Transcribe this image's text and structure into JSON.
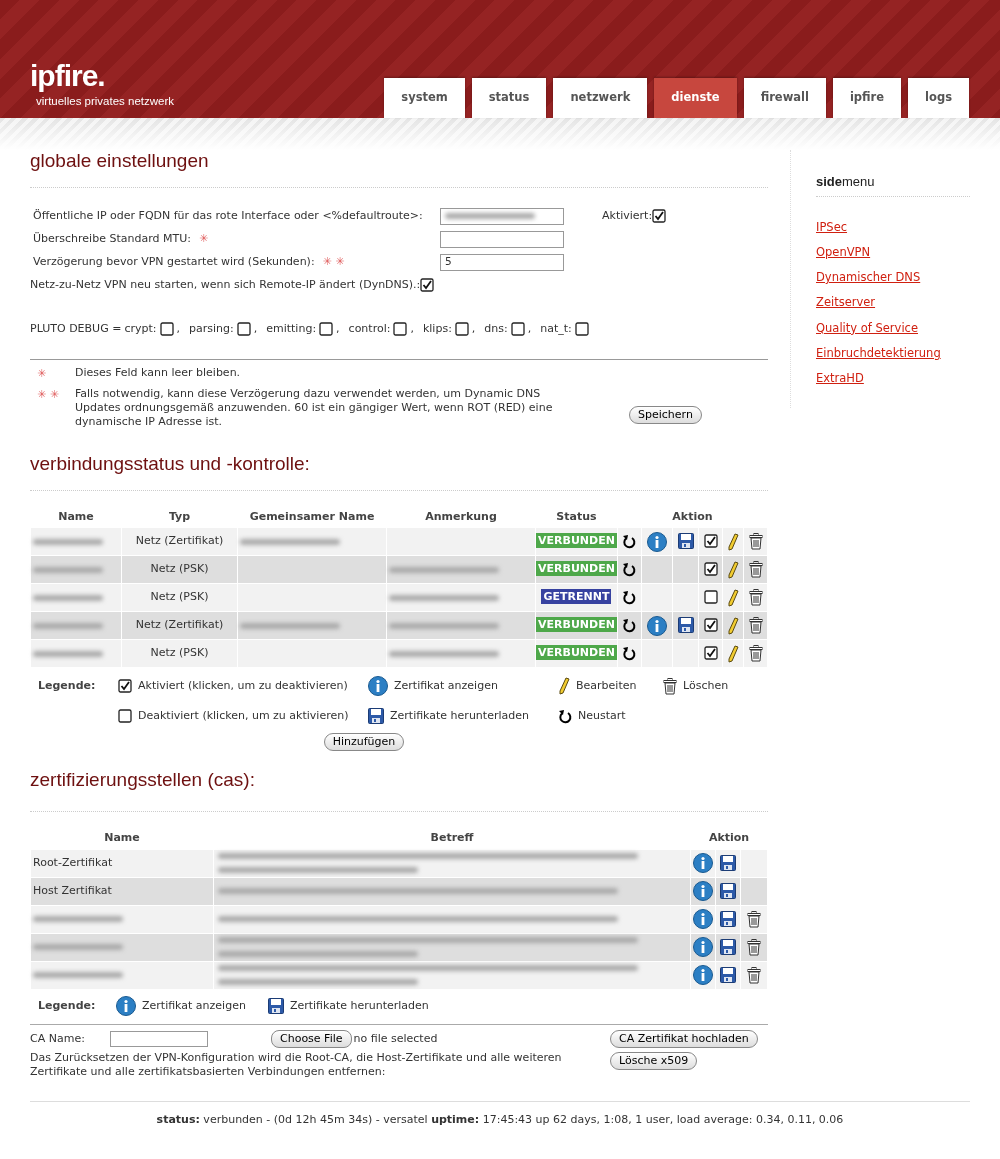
{
  "header": {
    "logo": "ipfire.",
    "tagline": "virtuelles privates netzwerk"
  },
  "tabs": [
    {
      "label": "system",
      "selected": false
    },
    {
      "label": "status",
      "selected": false
    },
    {
      "label": "netzwerk",
      "selected": false
    },
    {
      "label": "dienste",
      "selected": true
    },
    {
      "label": "firewall",
      "selected": false
    },
    {
      "label": "ipfire",
      "selected": false
    },
    {
      "label": "logs",
      "selected": false
    }
  ],
  "sidemenu": {
    "title": "**side**menu",
    "items": [
      "IPSec",
      "OpenVPN",
      "Dynamischer DNS",
      "Zeitserver",
      "Quality of Service",
      "Einbruchdetektierung",
      "ExtraHD"
    ]
  },
  "global": {
    "title": "globale einstellungen",
    "fields": [
      {
        "label": "Öffentliche IP oder FQDN für das rote Interface oder <%defaultroute>:",
        "redacted": true
      },
      {
        "label": "Überschreibe Standard MTU:",
        "mark": "✳",
        "redacted": false
      },
      {
        "label": "Verzögerung bevor VPN gestartet wird (Sekunden):",
        "mark": "✳ ✳",
        "value": "5",
        "redacted": false
      }
    ],
    "enabled": {
      "label": "Aktiviert:",
      "checked": true
    },
    "restart": {
      "label": "Netz-zu-Netz VPN neu starten, wenn sich Remote-IP ändert (DynDNS).:",
      "checked": true
    },
    "debug_label": "PLUTO DEBUG =",
    "debug": [
      {
        "label": "crypt:",
        "checked": false,
        "separator": ","
      },
      {
        "label": "parsing:",
        "checked": false,
        "separator": ","
      },
      {
        "label": "emitting:",
        "checked": false,
        "separator": ","
      },
      {
        "label": "control:",
        "checked": false,
        "separator": ","
      },
      {
        "label": "klips:",
        "checked": false,
        "separator": ","
      },
      {
        "label": "dns:",
        "checked": false,
        "separator": ","
      },
      {
        "label": "nat_t:",
        "checked": false
      }
    ],
    "notes": [
      {
        "mark": "✳",
        "text": "Dieses Feld kann leer bleiben."
      },
      {
        "mark": "✳ ✳",
        "text": "Falls notwendig, kann diese Verzögerung dazu verwendet werden, um Dynamic DNS Updates ordnungsgemäß anzuwenden. 60 ist ein gängiger Wert, wenn ROT (RED) eine dynamische IP Adresse ist."
      }
    ],
    "save": "Speichern"
  },
  "connections": {
    "title": "verbindungsstatus und -kontrolle:",
    "columns": [
      "Name",
      "Typ",
      "Gemeinsamer Name",
      "Anmerkung",
      "Status",
      "Aktion"
    ],
    "rows": [
      {
        "name_redacted": true,
        "type": "Netz (Zertifikat)",
        "common_redacted": true,
        "note_redacted": false,
        "status": "VERBUNDEN",
        "color": "#4ea84a",
        "certificate": true,
        "enabled": true
      },
      {
        "name_redacted": true,
        "type": "Netz (PSK)",
        "common_redacted": false,
        "note_redacted": true,
        "status": "VERBUNDEN",
        "color": "#4ea84a",
        "certificate": false,
        "enabled": true
      },
      {
        "name_redacted": true,
        "type": "Netz (PSK)",
        "common_redacted": false,
        "note_redacted": true,
        "status": "GETRENNT",
        "color": "#3742a0",
        "certificate": false,
        "enabled": false
      },
      {
        "name_redacted": true,
        "type": "Netz (Zertifikat)",
        "common_redacted": true,
        "note_redacted": true,
        "status": "VERBUNDEN",
        "color": "#4ea84a",
        "certificate": true,
        "enabled": true
      },
      {
        "name_redacted": true,
        "type": "Netz (PSK)",
        "common_redacted": false,
        "note_redacted": true,
        "status": "VERBUNDEN",
        "color": "#4ea84a",
        "certificate": false,
        "enabled": true
      }
    ],
    "legend_label": "Legende:",
    "legend": [
      {
        "kind": "checked",
        "text": "Aktiviert (klicken, um zu deaktivieren)"
      },
      {
        "kind": "info",
        "text": "Zertifikat anzeigen"
      },
      {
        "kind": "pencil",
        "text": "Bearbeiten"
      },
      {
        "kind": "trash",
        "text": "Löschen"
      },
      {
        "kind": "unchecked",
        "text": "Deaktiviert (klicken, um zu aktivieren)"
      },
      {
        "kind": "floppy",
        "text": "Zertifikate herunterladen"
      },
      {
        "kind": "restart",
        "text": "Neustart"
      }
    ],
    "add": "Hinzufügen"
  },
  "cas": {
    "title": "zertifizierungsstellen (cas):",
    "columns": [
      "Name",
      "Betreff",
      "Aktion"
    ],
    "rows": [
      {
        "name": "Root-Zertifikat",
        "name_redacted": false,
        "subject_wraps": true,
        "deletable": false
      },
      {
        "name": "Host Zertifikat",
        "name_redacted": false,
        "subject_wraps": false,
        "deletable": false
      },
      {
        "name_redacted": true,
        "subject_wraps": false,
        "deletable": true
      },
      {
        "name_redacted": true,
        "subject_wraps": true,
        "deletable": true
      },
      {
        "name_redacted": true,
        "subject_wraps": true,
        "deletable": true
      }
    ],
    "legend_label": "Legende:",
    "legend": [
      {
        "kind": "info",
        "text": "Zertifikat anzeigen"
      },
      {
        "kind": "floppy",
        "text": "Zertifikate herunterladen"
      }
    ],
    "ca_name_label": "CA Name:",
    "choose_file": "Choose File",
    "no_file": "no file selected",
    "upload": "CA Zertifikat hochladen",
    "reset_text": "Das Zurücksetzen der VPN-Konfiguration wird die Root-CA, die Host-Zertifikate und alle weiteren Zertifikate und alle zertifikatsbasierten Verbindungen entfernen:",
    "delete": "Lösche x509"
  },
  "footer": "**status:** verbunden - (0d 12h 45m 34s) - versatel **uptime:** 17:45:43 up 62 days, 1:08, 1 user, load average: 0.34, 0.11, 0.06"
}
